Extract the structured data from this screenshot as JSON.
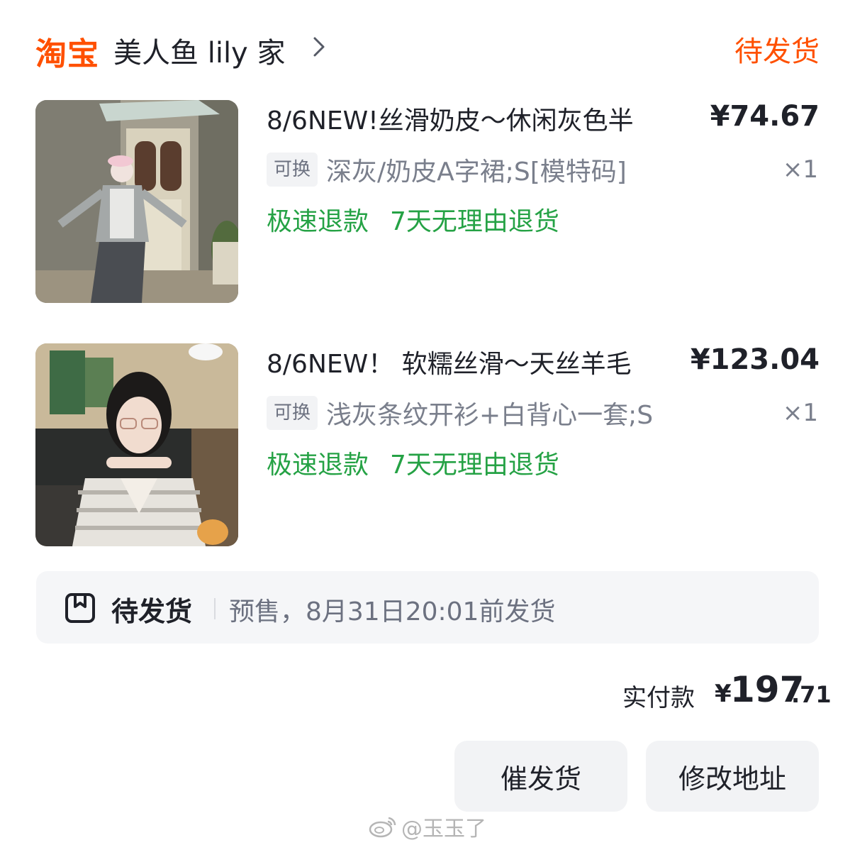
{
  "header": {
    "brand": "淘宝",
    "shop_name": "美人鱼 lily 家",
    "order_status": "待发货",
    "chevron_icon": "chevron-right-icon"
  },
  "items": [
    {
      "title": "8/6NEW!丝滑奶皮～休闲灰色半",
      "price": "¥74.67",
      "tag": "可换",
      "spec": "深灰/奶皮A字裙;S[模特码]",
      "quantity": "×1",
      "service_fast_refund": "极速退款",
      "service_return": "7天无理由退货"
    },
    {
      "title": "8/6NEW！ 软糯丝滑～天丝羊毛",
      "price": "¥123.04",
      "tag": "可换",
      "spec": "浅灰条纹开衫+白背心一套;S",
      "quantity": "×1",
      "service_fast_refund": "极速退款",
      "service_return": "7天无理由退货"
    }
  ],
  "shipping": {
    "icon": "package-box-icon",
    "label": "待发货",
    "note": "预售，8月31日20:01前发货"
  },
  "total": {
    "label": "实付款",
    "currency": "¥",
    "integer": "197",
    "decimal": ".71"
  },
  "actions": {
    "urge_label": "催发货",
    "address_label": "修改地址"
  },
  "watermark": {
    "icon": "weibo-icon",
    "text": "@玉玉了"
  },
  "colors": {
    "brand_orange": "#ff5000",
    "service_green": "#25a245",
    "text_primary": "#1f2129",
    "text_secondary": "#7a7f8c"
  }
}
